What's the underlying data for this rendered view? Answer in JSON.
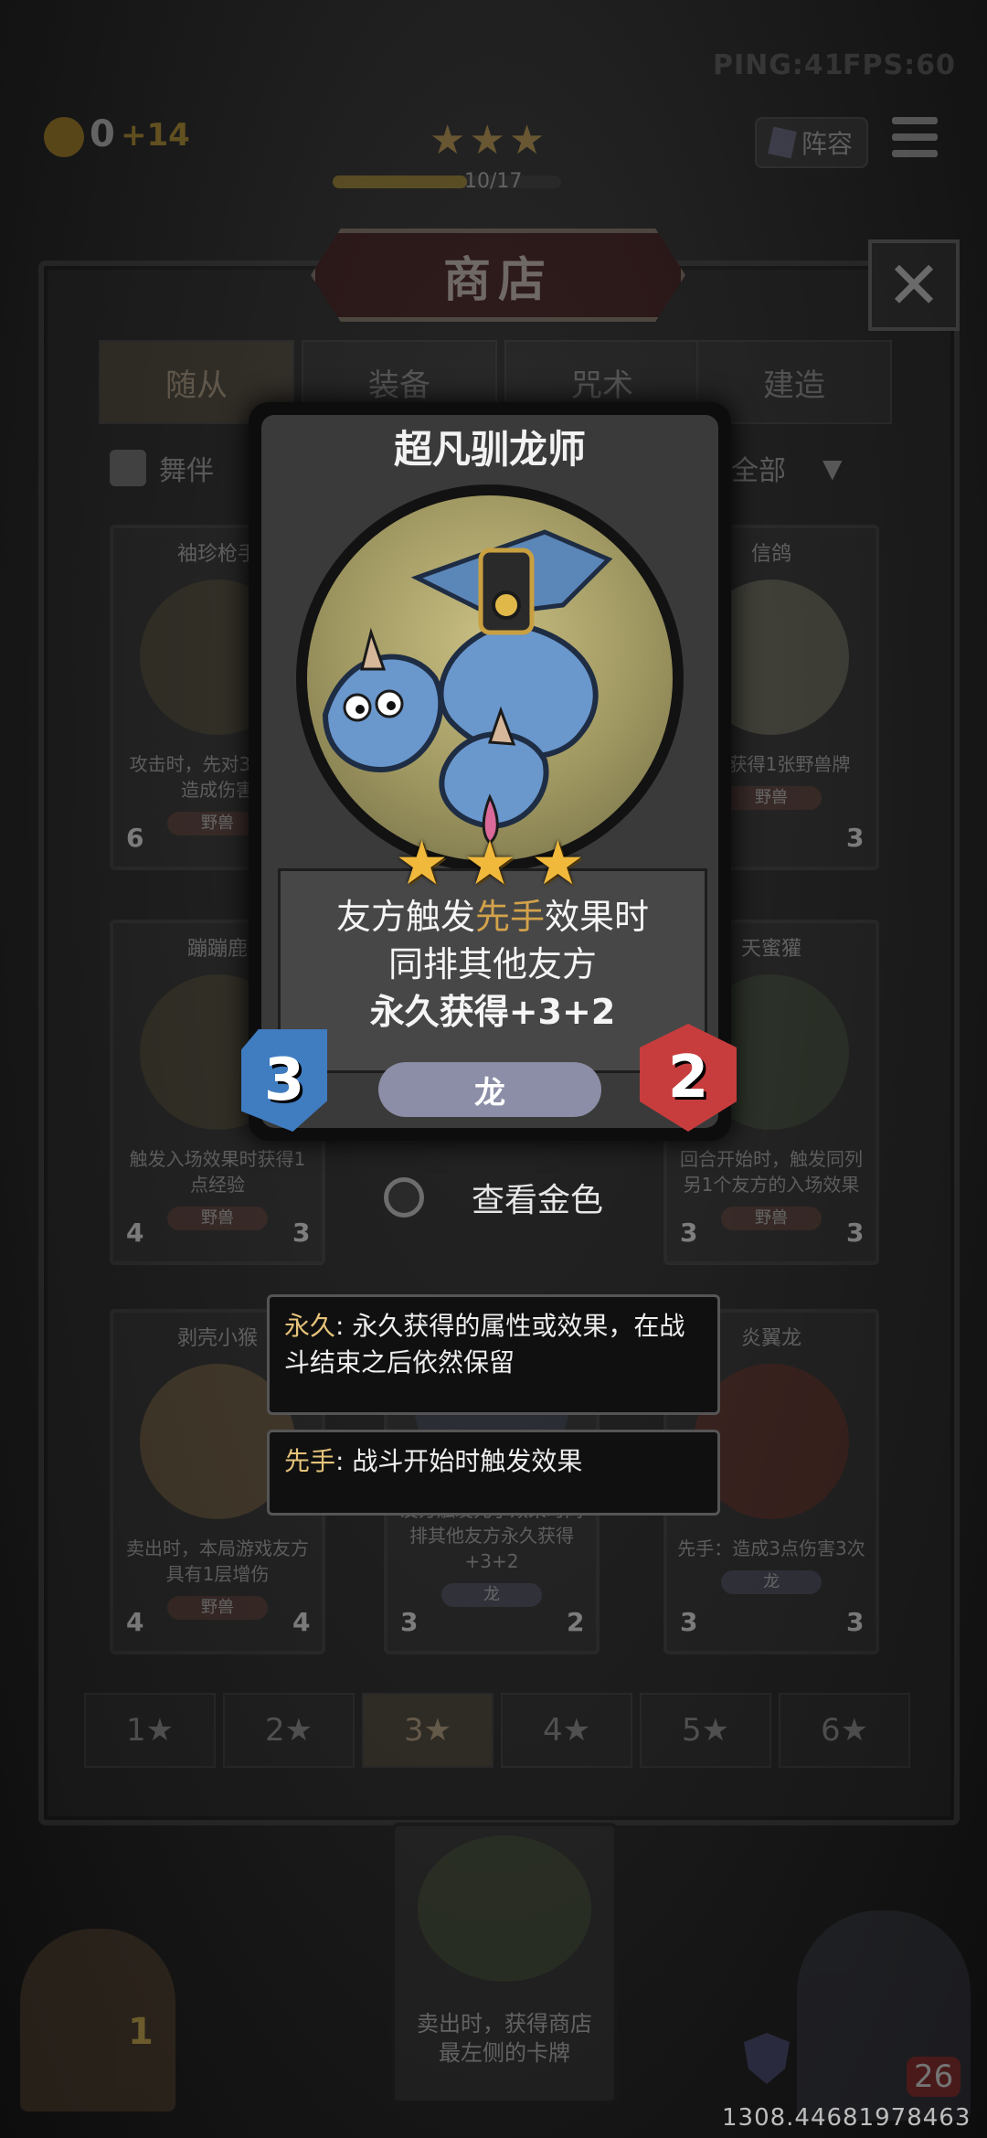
{
  "hud": {
    "ping": "PING:41",
    "fps": "FPS:60",
    "gold": "0",
    "gold_income": "+14",
    "progress": "10/17",
    "progress_fraction": 0.588,
    "lineup_label": "阵容",
    "level_stars": "★★★"
  },
  "shop": {
    "title": "商店",
    "close_label": "✕",
    "tabs": [
      {
        "label": "随从"
      },
      {
        "label": "装备"
      },
      {
        "label": "咒术"
      },
      {
        "label": "建造"
      }
    ],
    "filter_left": "舞伴",
    "filter_right": "全部",
    "slots": [
      {
        "name": "袖珍枪手",
        "desc": "攻击时，先对3个敌方造成伤害",
        "tribe": "野兽",
        "atk": "6",
        "hp": ""
      },
      {
        "name": "信鸽",
        "desc": "随机获得1张野兽牌",
        "tribe": "野兽",
        "atk": "",
        "hp": "3"
      },
      {
        "name": "蹦蹦鹿",
        "desc": "触发入场效果时获得1点经验",
        "tribe": "野兽",
        "atk": "4",
        "hp": "3"
      },
      {
        "name": "天蜜獾",
        "desc": "回合开始时，触发同列另1个友方的入场效果",
        "tribe": "野兽",
        "atk": "3",
        "hp": "3"
      },
      {
        "name": "剥壳小猴",
        "desc": "卖出时，本局游戏友方具有1层增伤",
        "tribe": "野兽",
        "atk": "4",
        "hp": "4"
      },
      {
        "name": "",
        "desc": "友方触发先手效果时同排其他友方永久获得+3+2",
        "tribe": "龙",
        "atk": "3",
        "hp": "2"
      },
      {
        "name": "炎翼龙",
        "desc": "先手：造成3点伤害3次",
        "tribe": "龙",
        "atk": "3",
        "hp": "3"
      }
    ],
    "star_filters": [
      "1★",
      "2★",
      "3★",
      "4★",
      "5★",
      "6★"
    ],
    "active_star_filter": 2
  },
  "card": {
    "name": "超凡驯龙师",
    "desc_line1_pre": "友方触发",
    "desc_line1_key": "先手",
    "desc_line1_post": "效果时",
    "desc_line2": "同排其他友方",
    "desc_line3": "永久获得+3+2",
    "tribe": "龙",
    "attack": "3",
    "health": "2",
    "stars": "★★★"
  },
  "view_gold": {
    "label": "查看金色",
    "checked": false
  },
  "tooltips": [
    {
      "key": "永久",
      "text": ": 永久获得的属性或效果，在战斗结束之后依然保留"
    },
    {
      "key": "先手",
      "text": ": 战斗开始时触发效果"
    }
  ],
  "bottom": {
    "sell_card_desc": "卖出时，获得商店最左侧的卡牌",
    "door_count": "1",
    "health_badge": "26",
    "coords": "1308.44681978463"
  },
  "colors": {
    "accent_gold": "#d3a24a",
    "attack_blue": "#3f7cc0",
    "health_red": "#c73d3d",
    "star": "#f0b93c"
  }
}
